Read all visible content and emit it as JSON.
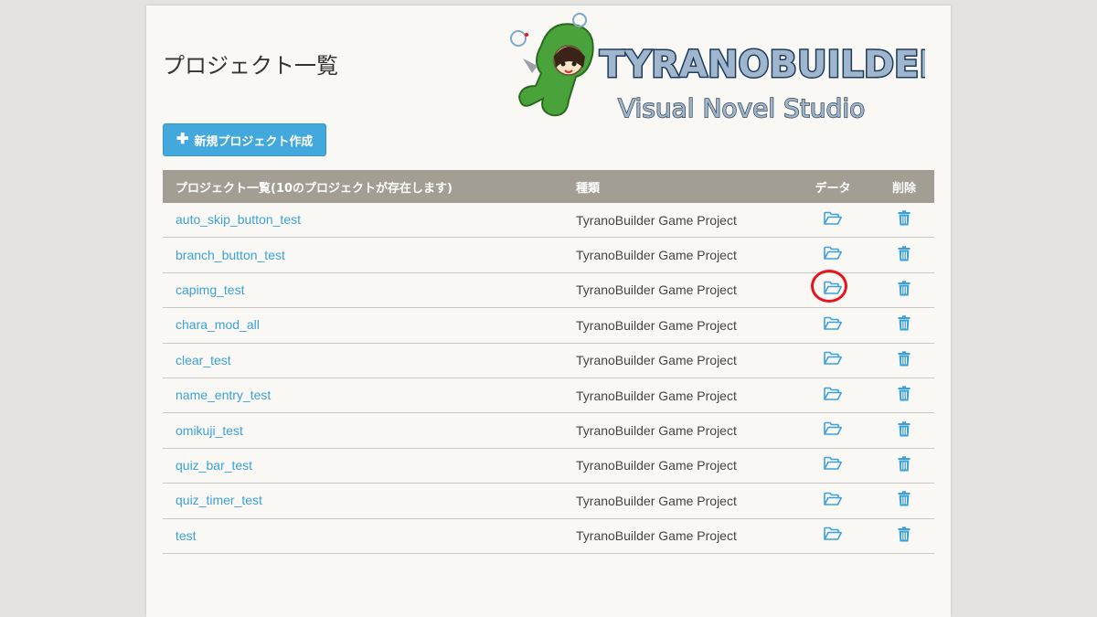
{
  "page": {
    "title": "プロジェクト一覧",
    "new_project_label": "新規プロジェクト作成"
  },
  "logo": {
    "brand_text": "TYRANOBUILDER",
    "tagline": "Visual Novel Studio"
  },
  "table": {
    "headers": {
      "name": "プロジェクト一覧(10のプロジェクトが存在します)",
      "type": "種類",
      "data": "データ",
      "delete": "削除"
    },
    "rows": [
      {
        "name": "auto_skip_button_test",
        "type": "TyranoBuilder Game Project"
      },
      {
        "name": "branch_button_test",
        "type": "TyranoBuilder Game Project"
      },
      {
        "name": "capimg_test",
        "type": "TyranoBuilder Game Project"
      },
      {
        "name": "chara_mod_all",
        "type": "TyranoBuilder Game Project"
      },
      {
        "name": "clear_test",
        "type": "TyranoBuilder Game Project"
      },
      {
        "name": "name_entry_test",
        "type": "TyranoBuilder Game Project"
      },
      {
        "name": "omikuji_test",
        "type": "TyranoBuilder Game Project"
      },
      {
        "name": "quiz_bar_test",
        "type": "TyranoBuilder Game Project"
      },
      {
        "name": "quiz_timer_test",
        "type": "TyranoBuilder Game Project"
      },
      {
        "name": "test",
        "type": "TyranoBuilder Game Project"
      }
    ]
  },
  "colors": {
    "accent": "#43a8db",
    "header_bg": "#a29e93",
    "link": "#3ba1d8",
    "icon": "#3ba1d8",
    "highlight": "#e8141b"
  },
  "icons": {
    "data": "folder-open-icon",
    "delete": "trash-icon",
    "new": "plus-icon"
  },
  "highlighted_row": 2
}
